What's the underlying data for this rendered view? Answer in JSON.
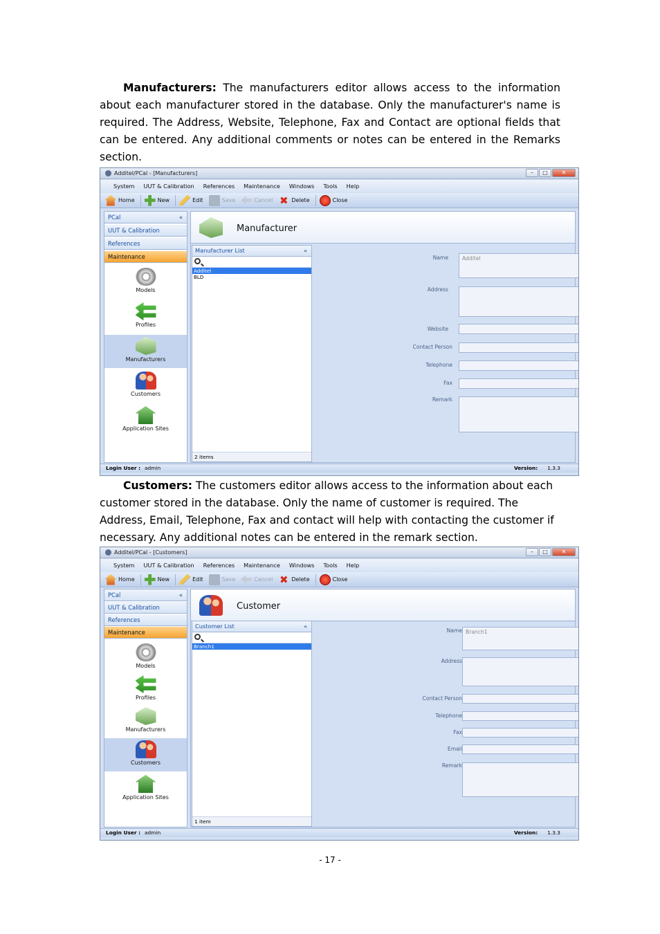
{
  "para1": {
    "lead": "Manufacturers:",
    "text": "The manufacturers editor allows access to the information about each manufacturer stored in the database. Only the manufacturer's name is required. The Address, Website, Telephone, Fax and Contact are optional fields that can be entered. Any additional comments or notes can be entered in the Remarks section."
  },
  "para2": {
    "lead": "Customers:",
    "text": "The customers editor allows access to the information about each customer stored in the database. Only the name of customer is required. The Address, Email, Telephone, Fax and contact will help with contacting the customer if necessary. Any additional notes can be entered in the remark section."
  },
  "app": {
    "menu": [
      "System",
      "UUT & Calibration",
      "References",
      "Maintenance",
      "Windows",
      "Tools",
      "Help"
    ],
    "toolbar": {
      "home": "Home",
      "new": "New",
      "edit": "Edit",
      "save": "Save",
      "cancel": "Cancel",
      "delete": "Delete",
      "close": "Close"
    },
    "nav": {
      "pcal": "PCal",
      "uut": "UUT & Calibration",
      "references": "References",
      "maintenance": "Maintenance",
      "collapse": "«"
    },
    "maintenance_items": [
      "Models",
      "Profiles",
      "Manufacturers",
      "Customers",
      "Application Sites"
    ],
    "status": {
      "login_label": "Login User :",
      "login_user": "admin",
      "version_label": "Version:",
      "version": "1.3.3"
    }
  },
  "screen1": {
    "window_title": "Additel/PCal - [Manufacturers]",
    "header_title": "Manufacturer",
    "list_title": "Manufacturer List",
    "list_items": [
      "Additel",
      "BLD"
    ],
    "list_count": "2 items",
    "fields": {
      "name": "Name",
      "name_value": "Additel",
      "address": "Address",
      "website": "Website",
      "contact": "Contact Person",
      "telephone": "Telephone",
      "fax": "Fax",
      "remark": "Remark"
    }
  },
  "screen2": {
    "window_title": "Additel/PCal - [Customers]",
    "header_title": "Customer",
    "list_title": "Customer List",
    "list_items": [
      "Branch1"
    ],
    "list_count": "1 item",
    "fields": {
      "name": "Name",
      "name_value": "Branch1",
      "address": "Address",
      "contact": "Contact Person",
      "telephone": "Telephone",
      "fax": "Fax",
      "email": "Email",
      "remark": "Remark"
    }
  },
  "page_number": "- 17 -"
}
